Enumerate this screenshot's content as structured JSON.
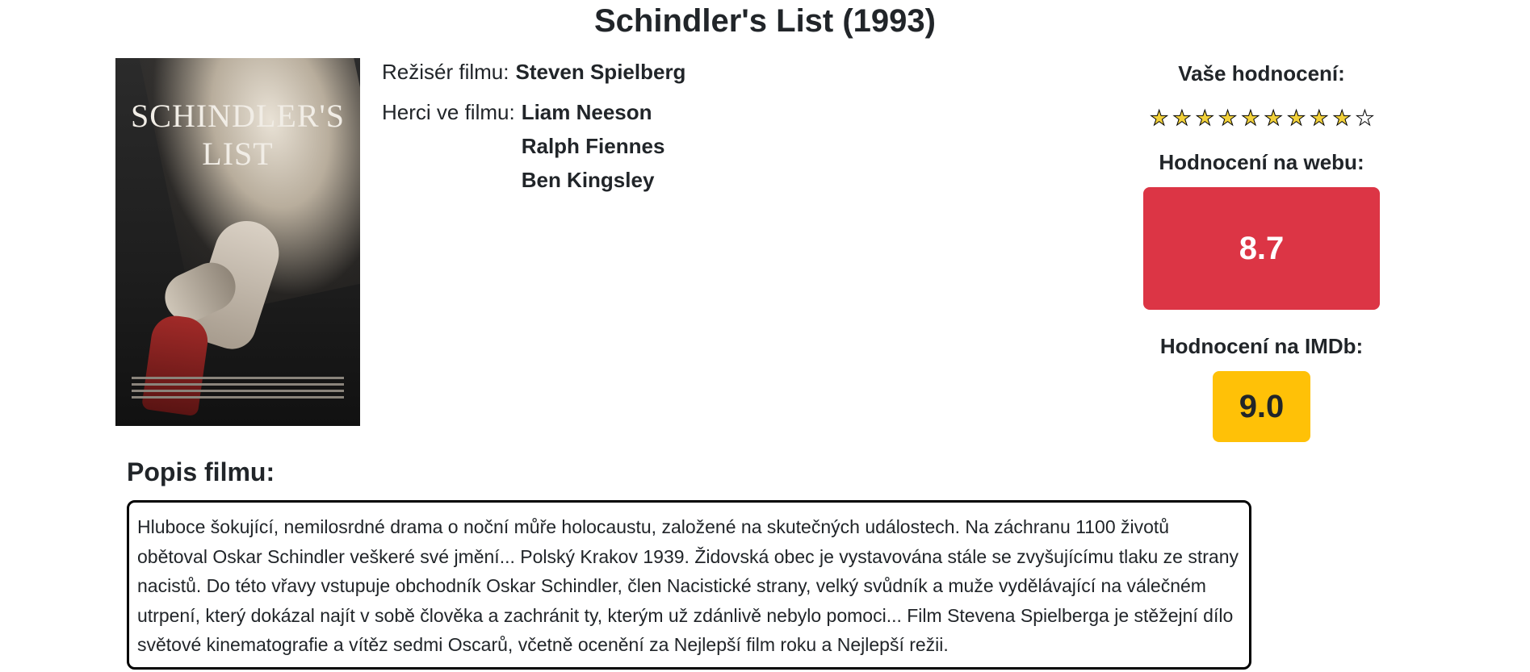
{
  "movie": {
    "title": "Schindler's List (1993)",
    "poster": {
      "title_text": "SCHINDLER'S LIST"
    },
    "director_label": "Režisér filmu:",
    "director": "Steven Spielberg",
    "actors_label": "Herci ve filmu:",
    "actors": [
      "Liam Neeson",
      "Ralph Fiennes",
      "Ben Kingsley"
    ]
  },
  "ratings": {
    "user_label": "Vaše hodnocení:",
    "user_stars_filled": 9,
    "user_stars_total": 10,
    "web_label": "Hodnocení na webu:",
    "web_value": "8.7",
    "web_color": "#dc3545",
    "imdb_label": "Hodnocení na IMDb:",
    "imdb_value": "9.0",
    "imdb_color": "#ffc107"
  },
  "description": {
    "heading": "Popis filmu:",
    "text": "Hluboce šokující, nemilosrdné drama o noční můře holocaustu, založené na skutečných událostech. Na záchranu 1100 životů obětoval Oskar Schindler veškeré své jmění... Polský Krakov 1939. Židovská obec je vystavována stále se zvyšujícímu tlaku ze strany nacistů. Do této vřavy vstupuje obchodník Oskar Schindler, člen Nacistické strany, velký svůdník a muže vydělávající na válečném utrpení, který dokázal najít v sobě člověka a zachránit ty, kterým už zdánlivě nebylo pomoci... Film Stevena Spielberga je stěžejní dílo světové kinematografie a vítěz sedmi Oscarů, včetně ocenění za Nejlepší film roku a Nejlepší režii."
  }
}
